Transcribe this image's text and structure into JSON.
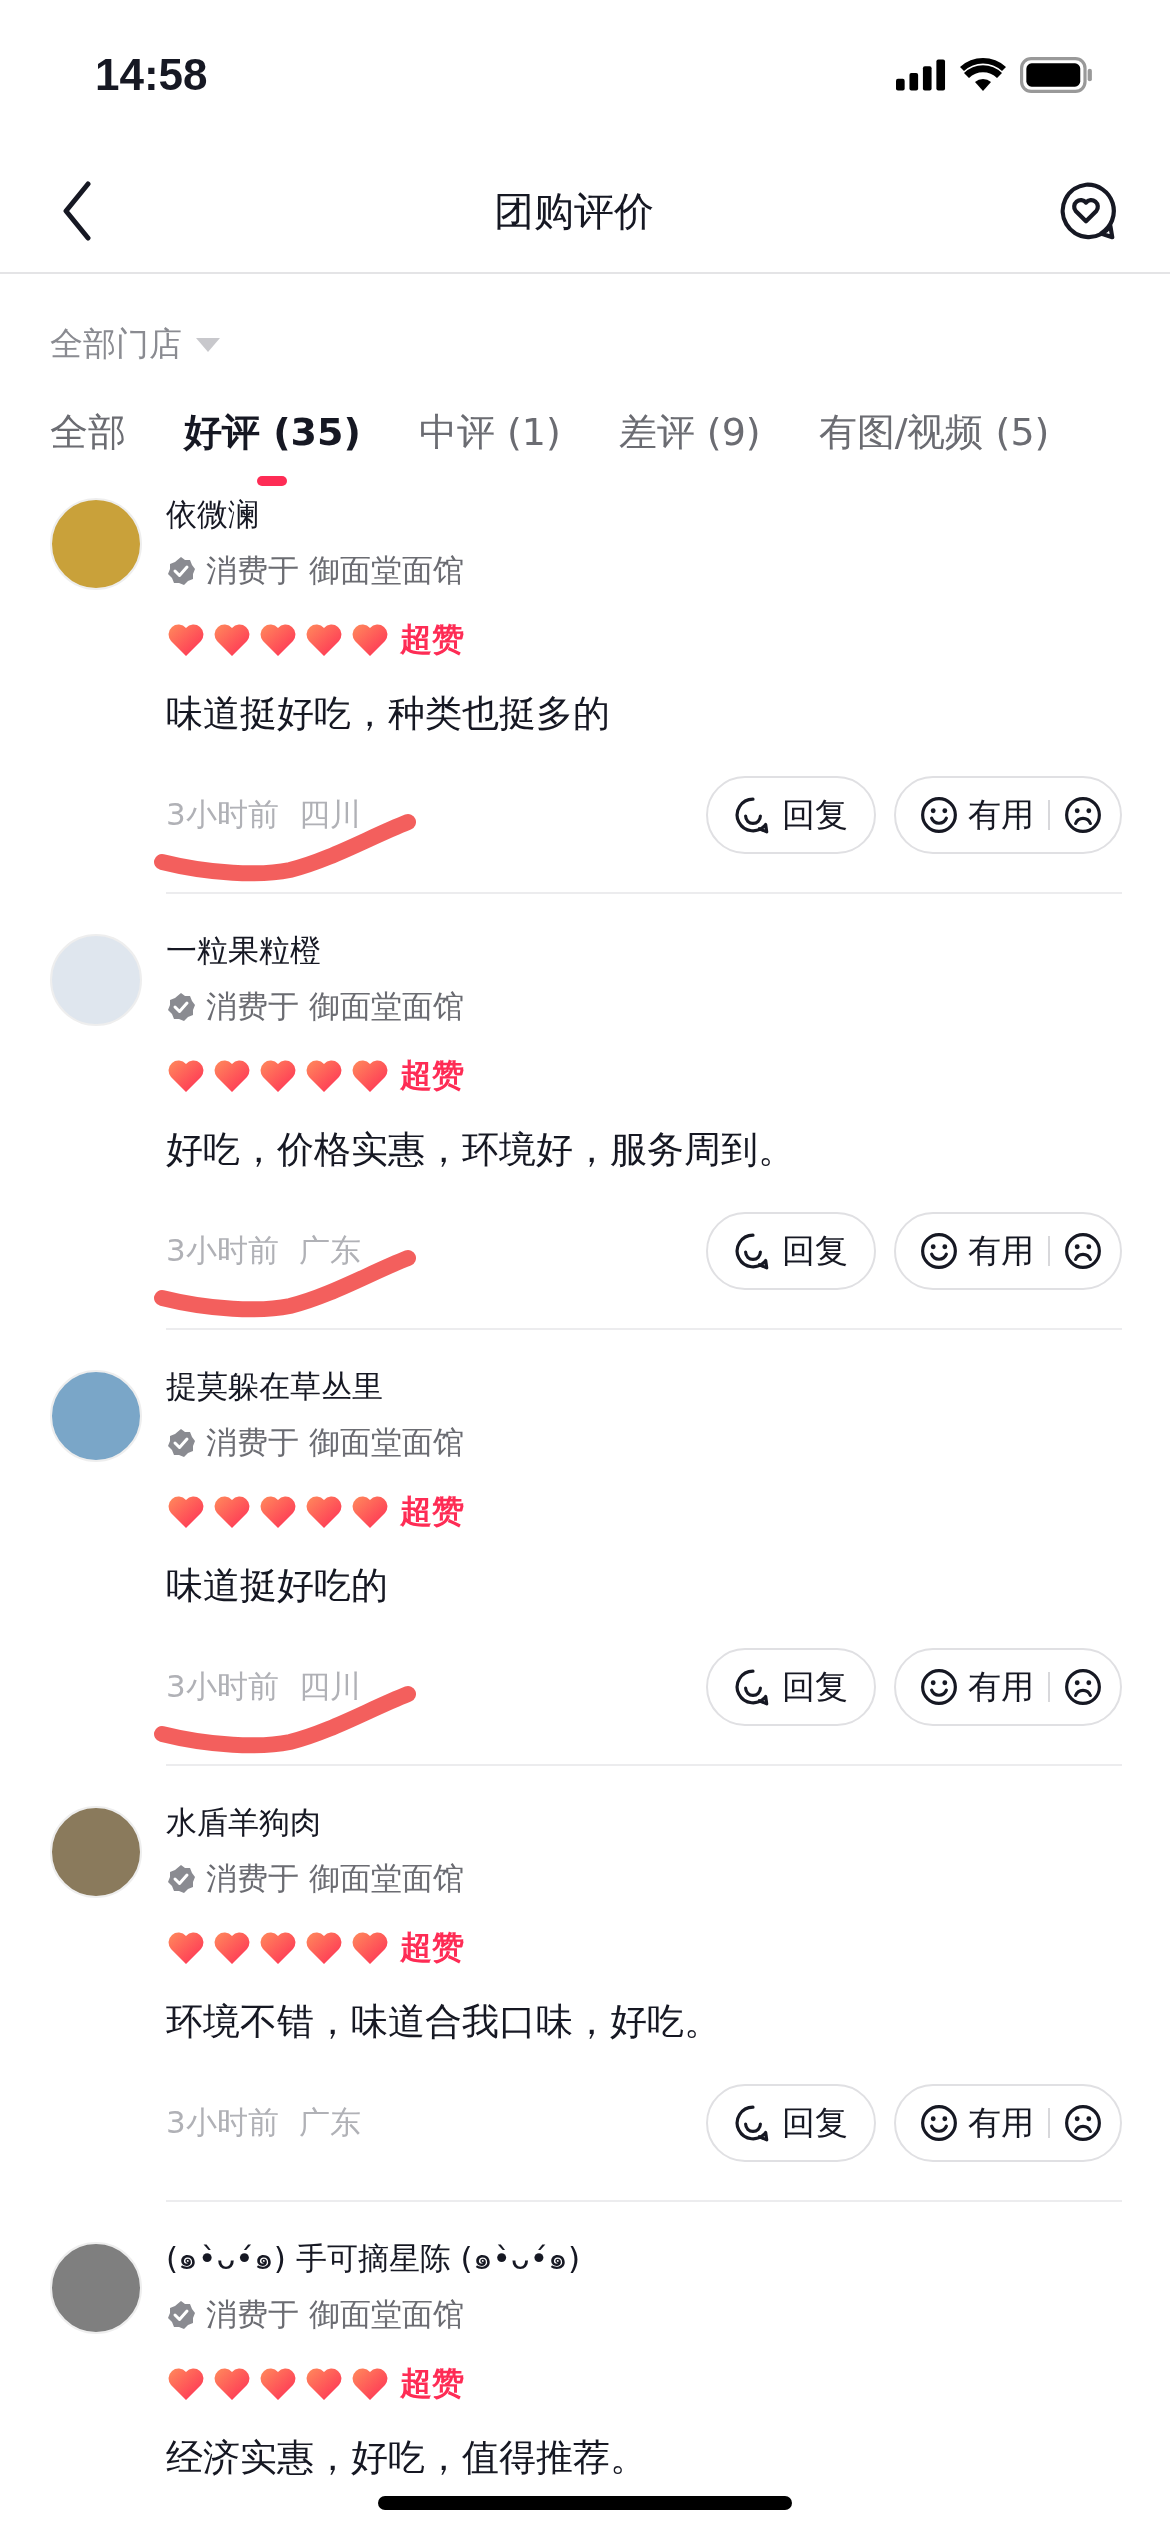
{
  "status_bar": {
    "time": "14:58"
  },
  "nav": {
    "title": "团购评价"
  },
  "store_filter": {
    "label": "全部门店"
  },
  "tabs": [
    {
      "label": "全部",
      "selected": false
    },
    {
      "label": "好评 (35)",
      "selected": true
    },
    {
      "label": "中评 (1)",
      "selected": false
    },
    {
      "label": "差评 (9)",
      "selected": false
    },
    {
      "label": "有图/视频 (5)",
      "selected": false
    }
  ],
  "reviews": [
    {
      "user": "依微澜",
      "store_line": "消费于 御面堂面馆",
      "stars": 5,
      "rating_label": "超赞",
      "text": "味道挺好吃，种类也挺多的",
      "time": "3小时前",
      "location": "四川",
      "reply_label": "回复",
      "useful_label": "有用",
      "underlined": true
    },
    {
      "user": "一粒果粒橙",
      "store_line": "消费于 御面堂面馆",
      "stars": 5,
      "rating_label": "超赞",
      "text": "好吃，价格实惠，环境好，服务周到。",
      "time": "3小时前",
      "location": "广东",
      "reply_label": "回复",
      "useful_label": "有用",
      "underlined": true
    },
    {
      "user": "提莫躲在草丛里",
      "store_line": "消费于 御面堂面馆",
      "stars": 5,
      "rating_label": "超赞",
      "text": "味道挺好吃的",
      "time": "3小时前",
      "location": "四川",
      "reply_label": "回复",
      "useful_label": "有用",
      "underlined": true
    },
    {
      "user": "水盾羊狗肉",
      "store_line": "消费于 御面堂面馆",
      "stars": 5,
      "rating_label": "超赞",
      "text": "环境不错，味道合我口味，好吃。",
      "time": "3小时前",
      "location": "广东",
      "reply_label": "回复",
      "useful_label": "有用",
      "underlined": false
    },
    {
      "user": "(๑•̀ᴗ•́๑) 手可摘星陈 (๑•̀ᴗ•́๑)",
      "store_line": "消费于 御面堂面馆",
      "stars": 5,
      "rating_label": "超赞",
      "text": "经济实惠，好吃，值得推荐。",
      "underlined": false
    }
  ]
}
